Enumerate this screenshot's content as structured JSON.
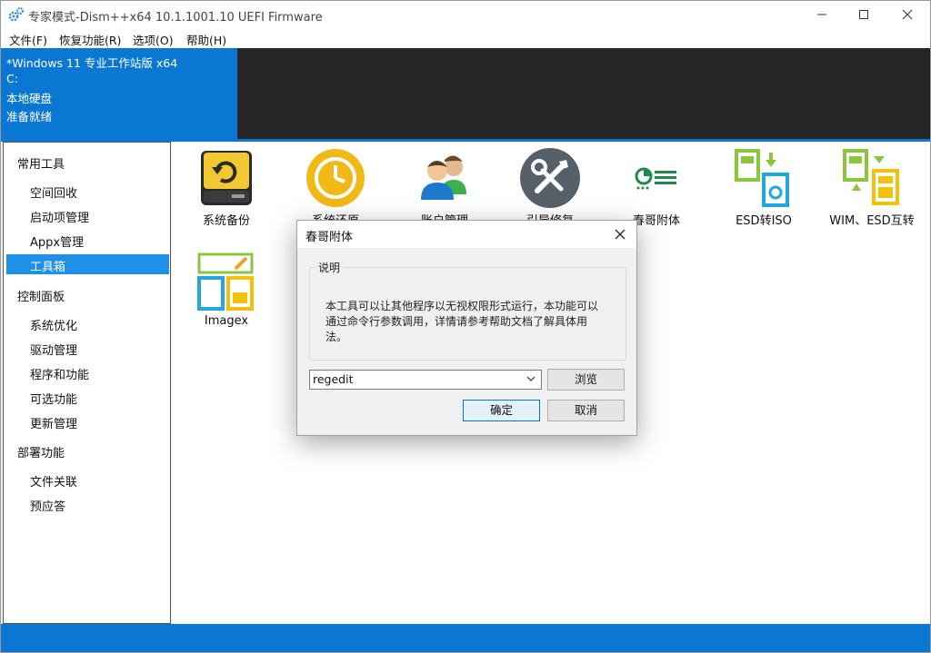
{
  "window": {
    "title": "专家模式-Dism++x64 10.1.1001.10 UEFI Firmware",
    "controls": [
      "minimize-icon",
      "maximize-icon",
      "close-icon"
    ]
  },
  "menu": [
    "文件(F)",
    "恢复功能(R)",
    "选项(O)",
    "帮助(H)"
  ],
  "header": {
    "lines": [
      "*Windows 11 专业工作站版 x64",
      "C:",
      "本地硬盘",
      "准备就绪"
    ],
    "accent": "#0a78d2",
    "dark": "#262626"
  },
  "sidebar": {
    "groups": [
      {
        "label": "常用工具",
        "items": [
          "空间回收",
          "启动项管理",
          "Appx管理",
          "工具箱"
        ]
      },
      {
        "label": "控制面板",
        "items": [
          "系统优化",
          "驱动管理",
          "程序和功能",
          "可选功能",
          "更新管理"
        ]
      },
      {
        "label": "部署功能",
        "items": [
          "文件关联",
          "预应答"
        ]
      }
    ],
    "selected": "工具箱"
  },
  "tools": [
    {
      "label": "系统备份",
      "icon": "drive-backup-icon"
    },
    {
      "label": "系统还原",
      "icon": "clock-restore-icon"
    },
    {
      "label": "账户管理",
      "icon": "users-icon"
    },
    {
      "label": "引导修复",
      "icon": "tools-repair-icon"
    },
    {
      "label": "春哥附体",
      "icon": "chunge-icon"
    },
    {
      "label": "ESD转ISO",
      "icon": "esd-iso-icon"
    },
    {
      "label": "WIM、ESD互转",
      "icon": "wim-esd-icon"
    },
    {
      "label": "Imagex",
      "icon": "imagex-icon"
    }
  ],
  "dialog": {
    "title": "春哥附体",
    "group_label": "说明",
    "description": "本工具可以让其他程序以无视权限形式运行，本功能可以通过命令行参数调用，详情请参考帮助文档了解具体用法。",
    "combo_value": "regedit",
    "browse_label": "浏览",
    "ok_label": "确定",
    "cancel_label": "取消"
  }
}
